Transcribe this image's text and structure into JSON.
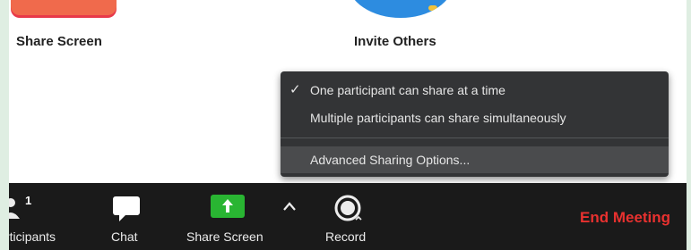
{
  "main": {
    "tiles": [
      {
        "label": "Share Screen",
        "color": "#f06a4c"
      },
      {
        "label": "Invite Others",
        "color": "#2d8ce0"
      }
    ]
  },
  "share_menu": {
    "items": [
      {
        "label": "One participant can share at a time",
        "checked": true
      },
      {
        "label": "Multiple participants can share simultaneously",
        "checked": false
      }
    ],
    "advanced_label": "Advanced Sharing Options..."
  },
  "toolbar": {
    "participants_label": "Participants",
    "participants_visible": "rticipants",
    "participants_count": "1",
    "chat_label": "Chat",
    "share_label": "Share Screen",
    "record_label": "Record",
    "end_meeting_label": "End Meeting",
    "share_color": "#29b532",
    "end_color": "#e8312f",
    "icons": [
      "participants-icon",
      "chat-icon",
      "share-screen-arrow-icon",
      "chevron-up-icon",
      "record-icon"
    ]
  }
}
